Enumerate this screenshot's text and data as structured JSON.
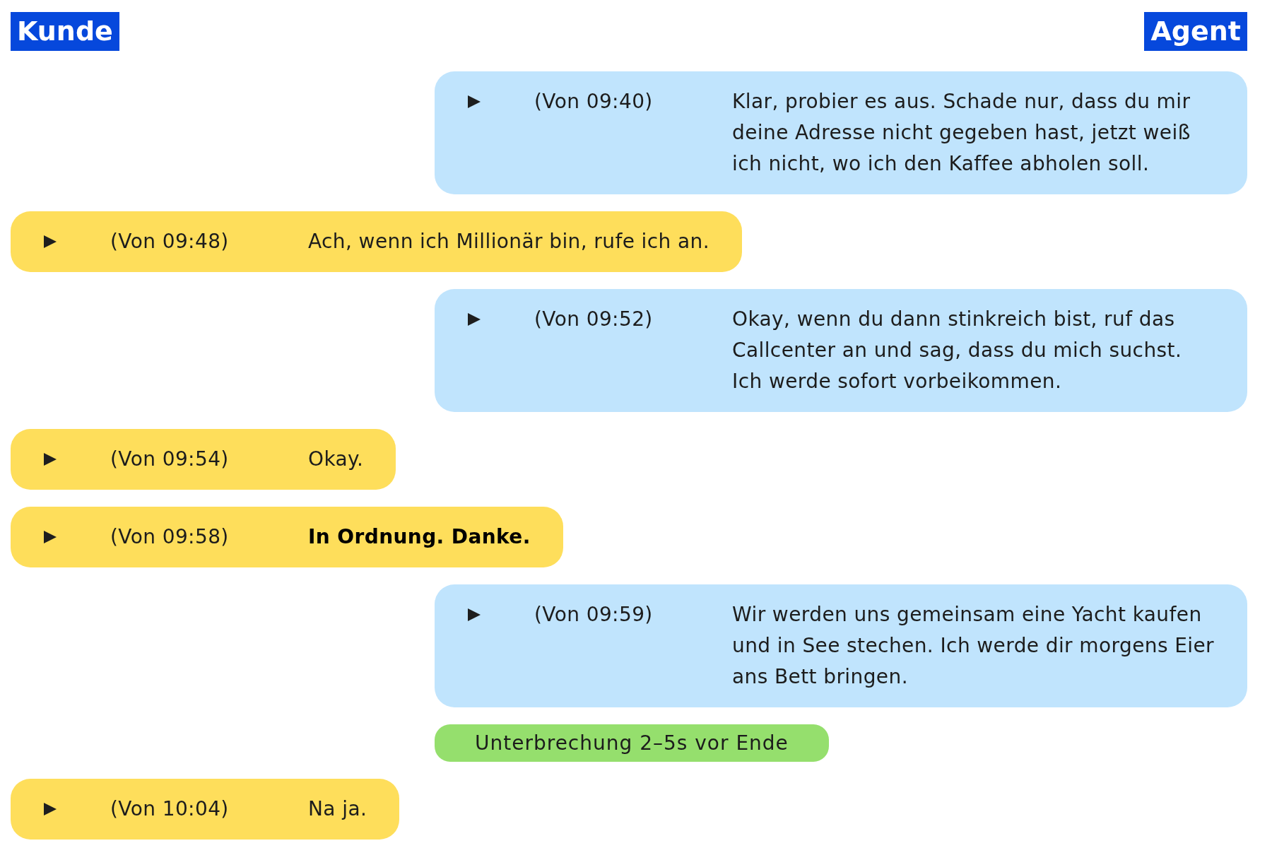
{
  "header": {
    "customer_label": "Kunde",
    "agent_label": "Agent"
  },
  "transcript": [
    {
      "kind": "message",
      "from_agent": true,
      "time": "(Von 09:40)",
      "text": "Klar, probier es aus. Schade nur, dass du mir deine Adresse nicht gegeben hast, jetzt weiß ich nicht, wo ich den Kaffee abholen soll.",
      "emphasized": false
    },
    {
      "kind": "message",
      "from_agent": false,
      "time": "(Von 09:48)",
      "text": "Ach, wenn ich Millionär bin, rufe ich an.",
      "emphasized": false
    },
    {
      "kind": "message",
      "from_agent": true,
      "time": "(Von 09:52)",
      "text": "Okay, wenn du dann stinkreich bist, ruf das Callcenter an und sag, dass du mich suchst. Ich werde sofort vorbeikommen.",
      "emphasized": false
    },
    {
      "kind": "message",
      "from_agent": false,
      "time": "(Von 09:54)",
      "text": "Okay.",
      "emphasized": false
    },
    {
      "kind": "message",
      "from_agent": false,
      "time": "(Von 09:58)",
      "text": "In Ordnung. Danke.",
      "emphasized": true
    },
    {
      "kind": "message",
      "from_agent": true,
      "time": "(Von 09:59)",
      "text": "Wir werden uns gemeinsam eine Yacht kaufen und in See stechen. Ich werde dir morgens Eier ans Bett bringen.",
      "emphasized": false
    },
    {
      "kind": "note",
      "text": "Unterbrechung 2–5s vor Ende"
    },
    {
      "kind": "message",
      "from_agent": false,
      "time": "(Von 10:04)",
      "text": "Na ja.",
      "emphasized": false
    }
  ]
}
